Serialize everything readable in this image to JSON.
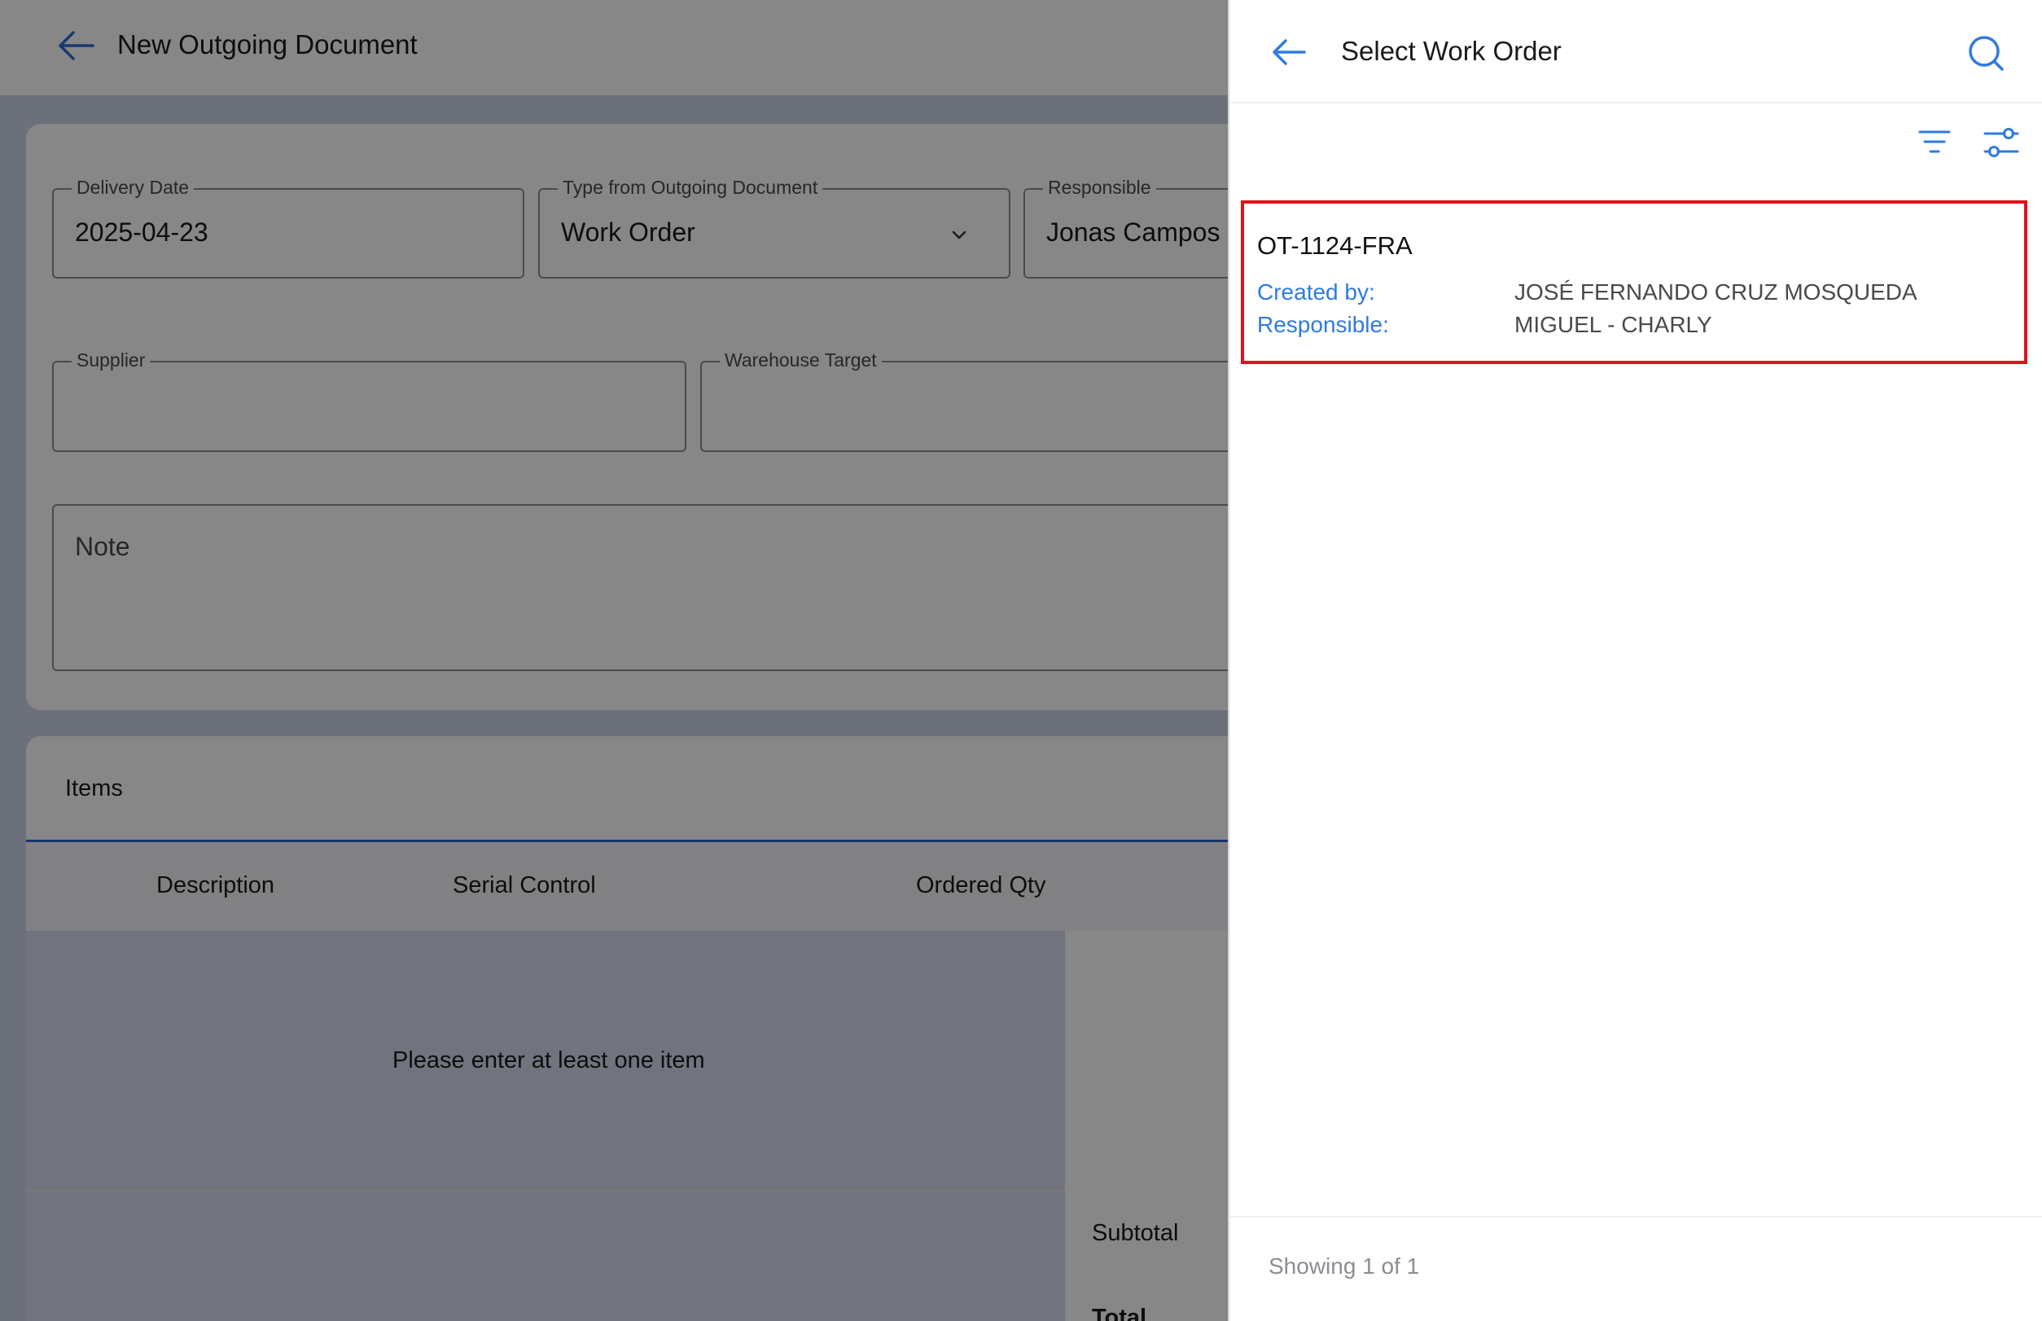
{
  "background": {
    "title": "New Outgoing Document",
    "fields": {
      "delivery_date": {
        "label": "Delivery Date",
        "value": "2025-04-23"
      },
      "type": {
        "label": "Type from Outgoing Document",
        "value": "Work Order"
      },
      "responsible": {
        "label": "Responsible",
        "value": "Jonas Campos"
      },
      "supplier": {
        "label": "Supplier",
        "value": ""
      },
      "warehouse": {
        "label": "Warehouse Target",
        "value": ""
      },
      "note": {
        "placeholder": "Note"
      }
    },
    "items": {
      "title": "Items",
      "columns": [
        "Description",
        "Serial Control",
        "Ordered Qty"
      ],
      "empty_message": "Please enter at least one item",
      "subtotal_label": "Subtotal",
      "total_label": "Total"
    }
  },
  "panel": {
    "title": "Select Work Order",
    "icons": [
      "back-arrow-icon",
      "search-icon",
      "filter-list-icon",
      "tune-icon"
    ],
    "work_orders": [
      {
        "code": "OT-1124-FRA",
        "created_by_label": "Created by:",
        "created_by": "JOSÉ FERNANDO CRUZ MOSQUEDA",
        "responsible_label": "Responsible:",
        "responsible": "MIGUEL - CHARLY"
      }
    ],
    "footer": "Showing 1 of 1"
  },
  "colors": {
    "accent": "#2f7be0",
    "highlight": "#e3101c",
    "tab_underline": "#2d64c8"
  }
}
